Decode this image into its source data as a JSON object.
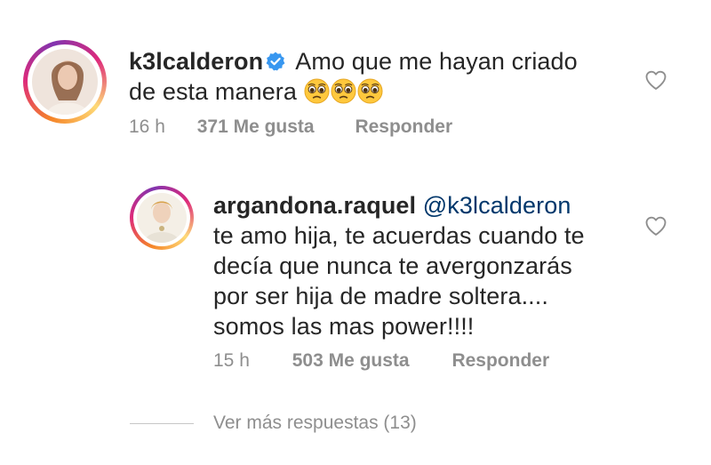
{
  "comment": {
    "username": "k3lcalderon",
    "text_line1": "Amo que me hayan criado",
    "text_line2": "de esta manera",
    "emojis": [
      "pleading-face",
      "pleading-face",
      "pleading-face"
    ],
    "time": "16 h",
    "likes": "371 Me gusta",
    "reply_label": "Responder",
    "verified": true
  },
  "reply": {
    "username": "argandona.raquel",
    "mention": "@k3lcalderon",
    "lines": [
      "te amo hija, te acuerdas cuando te",
      "decía que nunca te avergonzarás",
      "por ser hija de madre soltera....",
      "somos las mas power!!!!"
    ],
    "time": "15 h",
    "likes": "503 Me gusta",
    "reply_label": "Responder"
  },
  "more_replies": "Ver más respuestas (13)",
  "colors": {
    "text": "#262626",
    "muted": "#8e8e8e",
    "mention": "#00376b",
    "verified": "#3897f0"
  }
}
